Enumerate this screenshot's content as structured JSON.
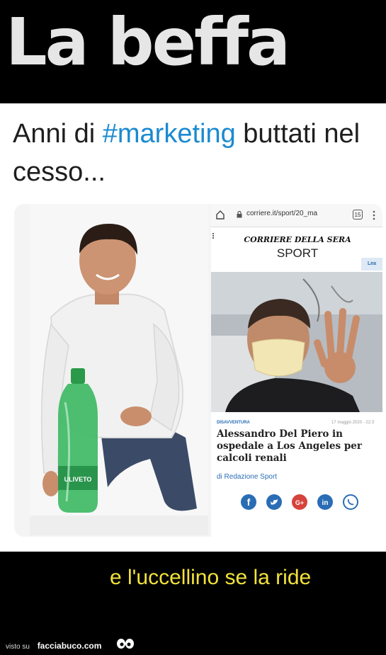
{
  "header": {
    "title": "La beffa"
  },
  "tweet": {
    "text_before": "Anni di ",
    "hashtag": "#marketing",
    "text_after": " buttati nel cesso..."
  },
  "screenshot": {
    "url": "corriere.it/sport/20_ma",
    "tab_count": "15",
    "masthead": "CORRIERE DELLA SERA",
    "section": "SPORT",
    "badge": "Lea",
    "kicker": "DISAVVENTURA",
    "date": "17 maggio 2020 - 22:3",
    "headline": "Alessandro Del Piero in ospedale a Los Angeles per calcoli renali",
    "byline": "di Redazione Sport",
    "share_icons": [
      "facebook-icon",
      "twitter-icon",
      "google-plus-icon",
      "linkedin-icon",
      "whatsapp-icon"
    ]
  },
  "bottom": {
    "caption": "e l'uccellino se la ride",
    "footer_prefix": "visto su",
    "footer_brand": "facciabuco.com"
  },
  "colors": {
    "caption": "#f2e23a",
    "hashtag": "#1a8ad0",
    "link": "#2a6db5"
  }
}
